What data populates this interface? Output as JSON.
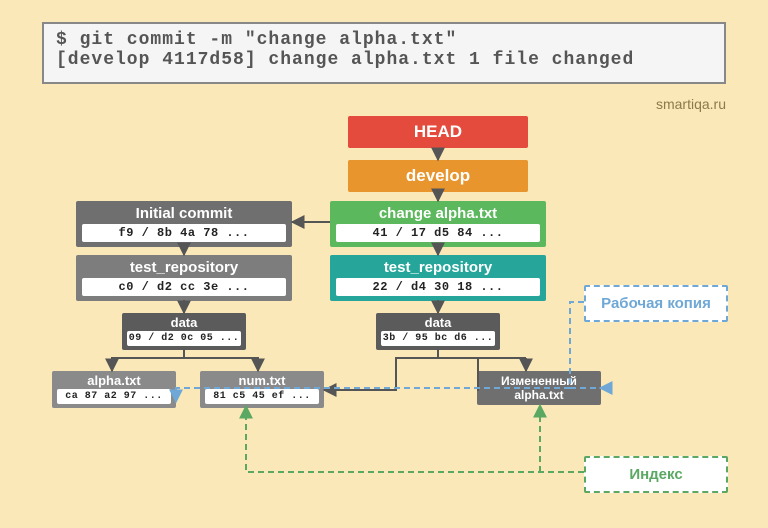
{
  "terminal": {
    "line1": "$ git commit -m \"change alpha.txt\"",
    "line2": "[develop 4117d58] change alpha.txt 1 file changed"
  },
  "watermark": "smartiqa.ru",
  "refs": {
    "head": "HEAD",
    "develop": "develop"
  },
  "left": {
    "commit": {
      "title": "Initial commit",
      "hash": "f9 / 8b 4a 78 ..."
    },
    "tree": {
      "title": "test_repository",
      "hash": "c0 / d2 cc 3e ..."
    },
    "data": {
      "title": "data",
      "hash": "09 / d2 0c 05 ..."
    },
    "alpha": {
      "title": "alpha.txt",
      "hash": "ca 87 a2 97 ..."
    },
    "num": {
      "title": "num.txt",
      "hash": "81 c5 45 ef ..."
    }
  },
  "right": {
    "commit": {
      "title": "change alpha.txt",
      "hash": "41 / 17 d5 84 ..."
    },
    "tree": {
      "title": "test_repository",
      "hash": "22 / d4 30 18 ..."
    },
    "data": {
      "title": "data",
      "hash": "3b / 95 bc d6 ..."
    },
    "alpha": {
      "title": "Измененный",
      "sub": "alpha.txt"
    }
  },
  "legend": {
    "working": "Рабочая копия",
    "index": "Индекс"
  },
  "colors": {
    "head": "#e54b3c",
    "develop": "#e8952e",
    "green": "#5cb85c",
    "teal": "#26a69a",
    "grayDark": "#5b5b5b",
    "gray": "#6f6f6f",
    "grayLight": "#7d7d7d",
    "grayLightest": "#8a8a8a",
    "border": "#888",
    "dashed": "#5aa862",
    "arrowBlue": "#6fa8d6"
  }
}
